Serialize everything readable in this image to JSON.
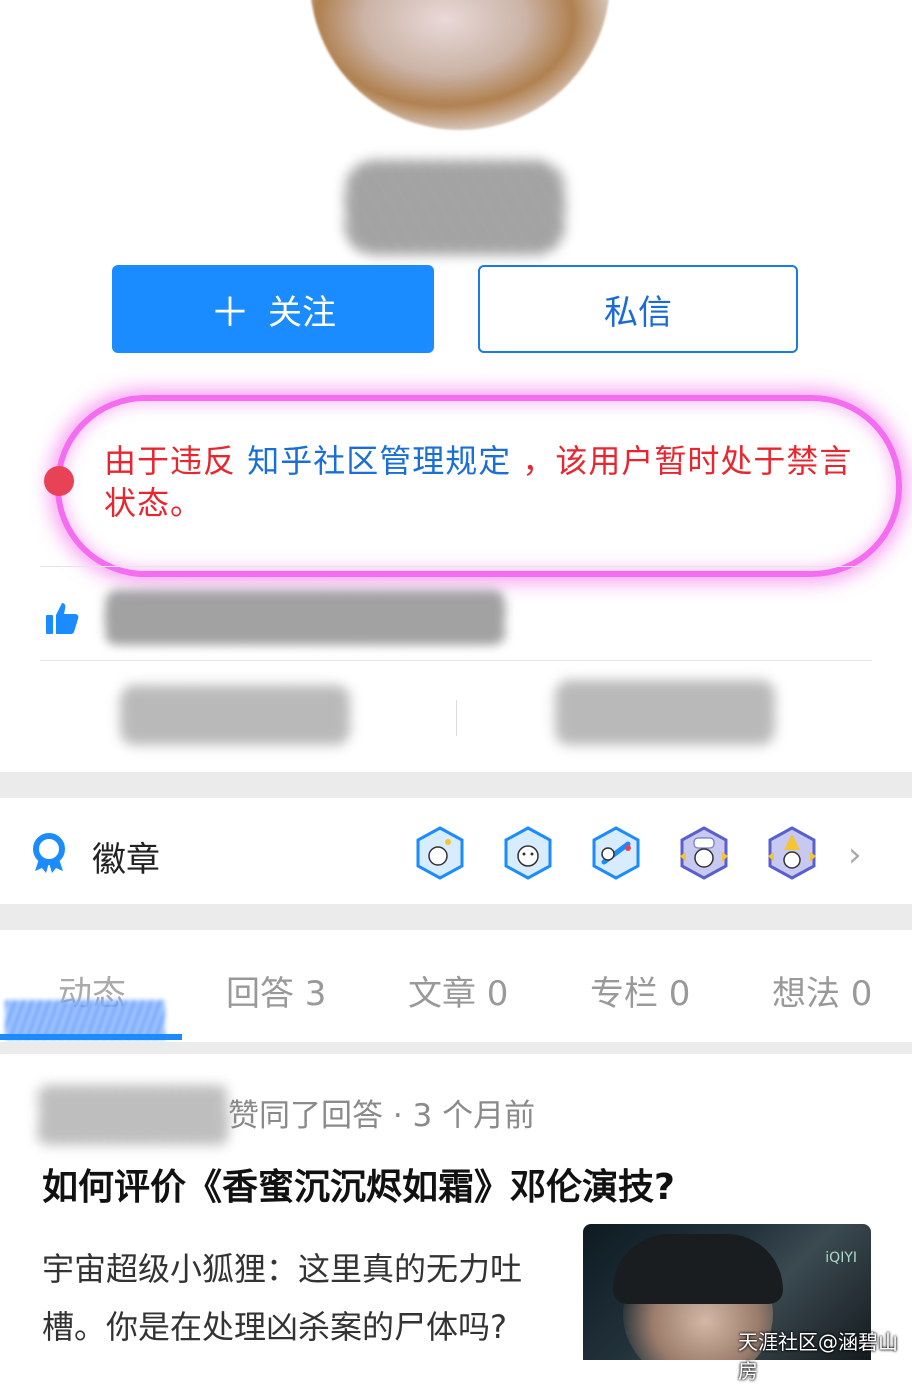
{
  "profile": {
    "follow_label": "关注",
    "follow_plus": "＋",
    "message_label": "私信"
  },
  "notice": {
    "prefix": "由于违反 ",
    "link": "知乎社区管理规定",
    "suffix": " ，该用户暂时处于禁言状态。"
  },
  "badges": {
    "label": "徽章",
    "chevron": "›"
  },
  "tabs": [
    {
      "label": "动态"
    },
    {
      "label": "回答 3"
    },
    {
      "label": "文章 0"
    },
    {
      "label": "专栏 0"
    },
    {
      "label": "想法 0"
    }
  ],
  "feed": {
    "meta": "赞同了回答 · 3 个月前",
    "title": "如何评价《香蜜沉沉烬如霜》邓伦演技?",
    "excerpt": "宇宙超级小狐狸：这里真的无力吐槽。你是在处理凶杀案的尸体吗?",
    "thumb_logo": "iQIYI"
  },
  "watermark": "天涯社区@涵碧山房",
  "colors": {
    "accent": "#1a8cff",
    "notice_red": "#e8262f",
    "notice_link": "#1a6fd6"
  }
}
